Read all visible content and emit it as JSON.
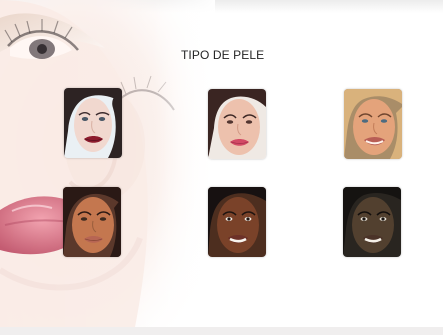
{
  "slide": {
    "title": "TIPO DE PELE"
  },
  "skin_types": [
    {
      "id": "skin-type-1",
      "image": "light-skin-dark-hair-face",
      "skin": "#f1d8cf",
      "hair": "#2d2323",
      "lips": "#8d1c2d",
      "bg": "#eaf0f4"
    },
    {
      "id": "skin-type-2",
      "image": "fair-skin-dark-hair-face",
      "skin": "#edc1ad",
      "hair": "#3a2522",
      "lips": "#d24a65",
      "bg": "#efe9e4"
    },
    {
      "id": "skin-type-3",
      "image": "light-tan-blonde-hair-face",
      "skin": "#e4a37b",
      "hair": "#d9b27c",
      "lips": "#b85e55",
      "bg": "#a98d68"
    },
    {
      "id": "skin-type-4",
      "image": "tan-skin-dark-hair-face",
      "skin": "#c4774f",
      "hair": "#2a1915",
      "lips": "#b76553",
      "bg": "#5b382b"
    },
    {
      "id": "skin-type-5",
      "image": "brown-skin-face",
      "skin": "#7a4229",
      "hair": "#171111",
      "lips": "#6c3128",
      "bg": "#4d2e1f"
    },
    {
      "id": "skin-type-6",
      "image": "dark-skin-face",
      "skin": "#52402f",
      "hair": "#151311",
      "lips": "#4b3328",
      "bg": "#292520"
    }
  ]
}
